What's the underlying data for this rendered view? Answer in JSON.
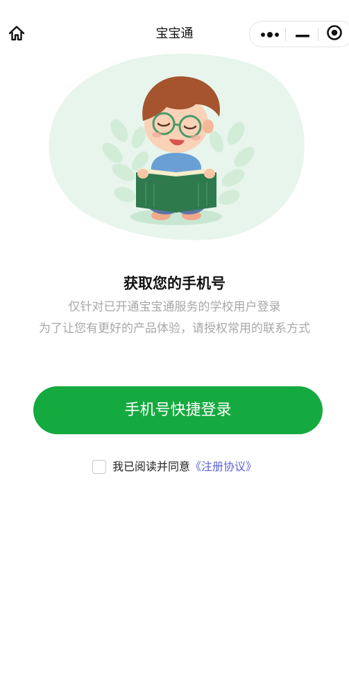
{
  "nav": {
    "title": "宝宝通",
    "home_icon": "home-icon",
    "capsule": {
      "more_icon": "more-dots-icon",
      "minimize_icon": "minimize-icon",
      "close_icon": "target-circle-icon"
    }
  },
  "illustration": {
    "icon": "boy-reading-book-illustration"
  },
  "content": {
    "heading": "获取您的手机号",
    "desc_line1": "仅针对已开通宝宝通服务的学校用户登录",
    "desc_line2": "为了让您有更好的产品体验，请授权常用的联系方式"
  },
  "login": {
    "button_label": "手机号快捷登录",
    "button_color": "#15aa3f"
  },
  "agreement": {
    "checked": false,
    "text": "我已阅读并同意",
    "link": "《注册协议》",
    "link_color": "#5a63d8"
  }
}
